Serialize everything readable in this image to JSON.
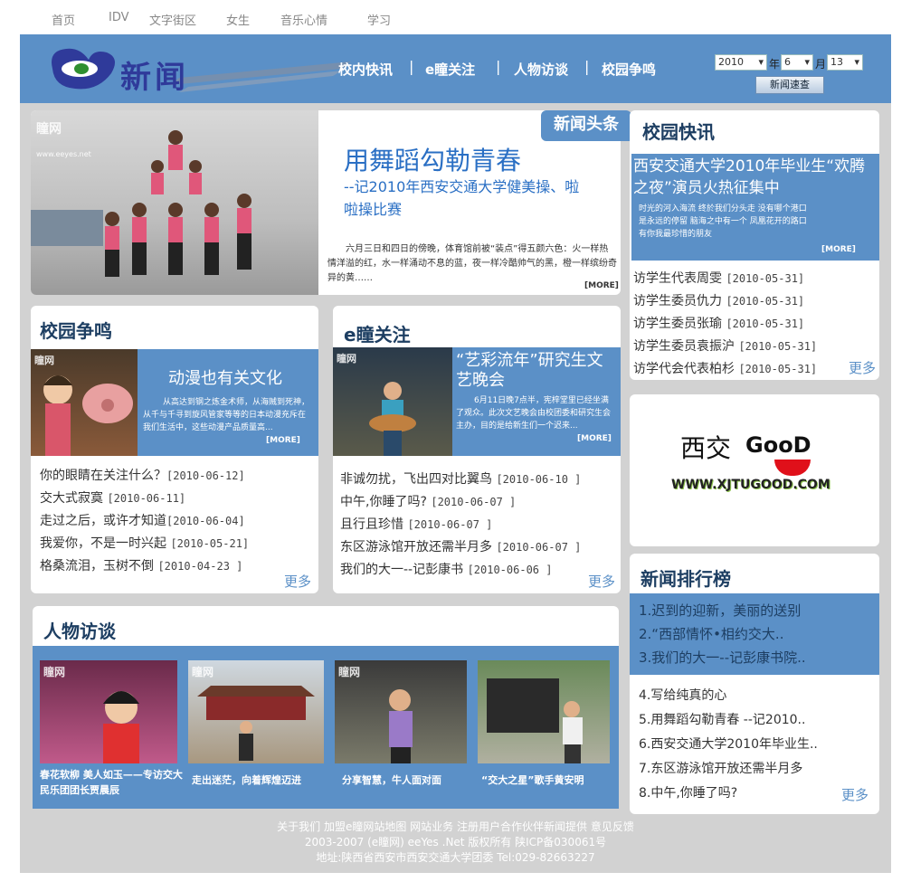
{
  "topnav": {
    "items": [
      "首页",
      "IDV",
      "文字街区",
      "女生",
      "音乐心情",
      "学习"
    ]
  },
  "header": {
    "logo_text": "新闻",
    "nav": [
      "校内快讯",
      "e瞳关注",
      "人物访谈",
      "校园争鸣"
    ],
    "date": {
      "year": "2010",
      "year_label": "年",
      "month": "6",
      "month_label": "月",
      "day": "13"
    },
    "search_button": "新闻速查"
  },
  "headline": {
    "badge": "新闻头条",
    "title": "用舞蹈勾勒青春",
    "subtitle": "--记2010年西安交通大学健美操、啦啦操比赛",
    "summary": "六月三日和四日的傍晚，体育馆前被“装点”得五颜六色：火一样热情洋溢的红，水一样涌动不息的蓝，夜一样冷酷帅气的黑，橙一样缤纷奇异的黄……",
    "more": "[MORE]",
    "watermark": "瞳网",
    "watermark_url": "www.eeyes.net"
  },
  "campus_news": {
    "title": "校园快讯",
    "feature_title": "西安交通大学2010年毕业生“欢腾之夜”演员火热征集中",
    "feature_text": "时光的河入海流 终於我们分头走 没有哪个港口 是永远的停留 脑海之中有一个 凤凰花开的路口 有你我最珍惜的朋友",
    "feature_more": "[MORE]",
    "items": [
      {
        "text": "访学生代表周雯",
        "date": "[2010-05-31]"
      },
      {
        "text": "访学生委员仇力",
        "date": "[2010-05-31]"
      },
      {
        "text": "访学生委员张瑜",
        "date": "[2010-05-31]"
      },
      {
        "text": "访学生委员袁振沪",
        "date": "[2010-05-31]"
      },
      {
        "text": "访学代会代表柏杉",
        "date": "[2010-05-31]"
      }
    ],
    "more": "更多"
  },
  "debate": {
    "title": "校园争鸣",
    "feature_title": "动漫也有关文化",
    "feature_text": "从高达到钢之炼金术师，从海贼到死神，从千与千寻到旋风管家等等的日本动漫充斥在我们生活中，这些动漫产品质量高...",
    "feature_more": "[MORE]",
    "items": [
      {
        "text": "你的眼睛在关注什么？",
        "date": "[2010-06-12]"
      },
      {
        "text": "交大式寂寞",
        "date": "[2010-06-11]"
      },
      {
        "text": "走过之后，或许才知道",
        "date": "[2010-06-04]"
      },
      {
        "text": "我爱你，不是一时兴起",
        "date": "[2010-05-21]"
      },
      {
        "text": "格桑流泪，玉树不倒",
        "date": "[2010-04-23 ]"
      }
    ],
    "more": "更多"
  },
  "focus": {
    "title": "e瞳关注",
    "feature_title": "“艺彩流年”研究生文艺晚会",
    "feature_text": "6月11日晚7点半，宪梓堂里已经坐满了观众。此次文艺晚会由校团委和研究生会主办，目的是给新生们一个迟来...",
    "feature_more": "[MORE]",
    "items": [
      {
        "text": "非诚勿扰，飞出四对比翼鸟",
        "date": "[2010-06-10 ]"
      },
      {
        "text": "中午,你睡了吗?",
        "date": "[2010-06-07 ]"
      },
      {
        "text": "且行且珍惜",
        "date": "[2010-06-07 ]"
      },
      {
        "text": "东区游泳馆开放还需半月多",
        "date": "[2010-06-07 ]"
      },
      {
        "text": "我们的大一--记彭康书",
        "date": "[2010-06-06 ]"
      }
    ],
    "more": "更多"
  },
  "ad": {
    "text1": "西交",
    "text2": "GooD",
    "url": "WWW.XJTUGOOD.COM"
  },
  "ranking": {
    "title": "新闻排行榜",
    "top": [
      "1.迟到的迎新，美丽的送别",
      "2.“西部情怀•相约交大..",
      "3.我们的大一--记彭康书院.."
    ],
    "rest": [
      "4.写给纯真的心",
      "5.用舞蹈勾勒青春 --记2010..",
      "6.西安交通大学2010年毕业生..",
      "7.东区游泳馆开放还需半月多",
      "8.中午,你睡了吗?"
    ],
    "more": "更多"
  },
  "interviews": {
    "title": "人物访谈",
    "items": [
      {
        "caption": "春花软柳 美人如玉——专访交大民乐团团长贾晨辰"
      },
      {
        "caption": "走出迷茫，向着辉煌迈进"
      },
      {
        "caption": "分享智慧，牛人面对面"
      },
      {
        "caption": "“交大之星”歌手黄安明"
      }
    ]
  },
  "footer": {
    "line1": "关于我们 加盟e瞳网站地图 网站业务 注册用户合作伙伴新闻提供 意见反馈",
    "line2": "2003-2007 (e瞳网) eeYes .Net 版权所有 陕ICP备030061号",
    "line3": "地址:陕西省西安市西安交通大学团委  Tel:029-82663227"
  },
  "colors": {
    "accent": "#5b90c7",
    "title": "#1d3e62",
    "headline": "#2a6fc4"
  }
}
